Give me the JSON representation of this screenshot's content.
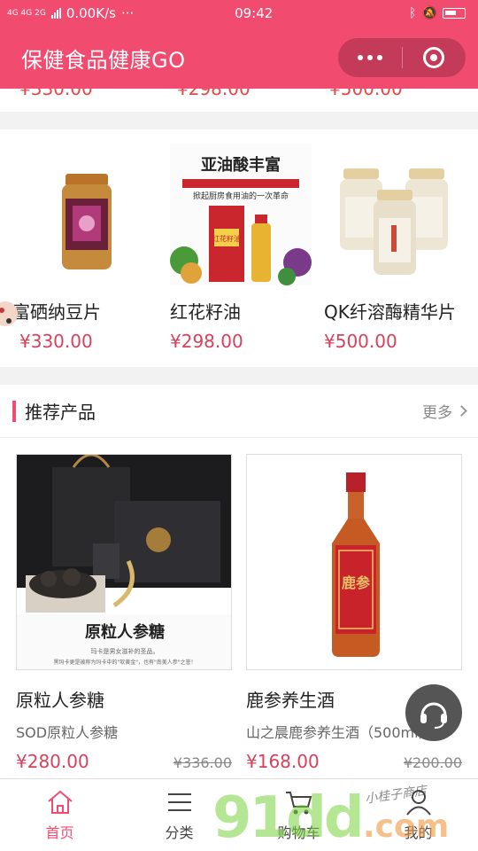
{
  "status_bar": {
    "network": "4G 4G 2G",
    "speed": "0.00K/s",
    "more": "···",
    "time": "09:42"
  },
  "header": {
    "title": "保健食品健康GO"
  },
  "hot_products": [
    {
      "name": "富硒纳豆片",
      "price": "¥330.00"
    },
    {
      "name": "红花籽油",
      "price": "¥298.00",
      "image_text": "亚油酸丰富",
      "image_subtext": "掀起厨房食用油的一次革命",
      "bottle_label": "红花籽油"
    },
    {
      "name": "QK纤溶酶精华片",
      "price": "¥500.00"
    }
  ],
  "recommend": {
    "title": "推荐产品",
    "more": "更多",
    "items": [
      {
        "name": "原粒人参糖",
        "desc": "SOD原粒人参糖",
        "price": "¥280.00",
        "old_price": "¥336.00",
        "image_text": "原粒人参糖",
        "image_small": "玛卡是男女滋补的圣品。",
        "image_small2": "黑玛卡更是被称为玛卡中的\"软黄金\"，也有\"南美人参\"之誉！"
      },
      {
        "name": "鹿参养生酒",
        "desc": "山之晨鹿参养生酒（500ml）",
        "price": "¥168.00",
        "old_price": "¥200.00",
        "label_text": "鹿参"
      }
    ]
  },
  "tabbar": [
    {
      "label": "首页",
      "icon": "home-icon"
    },
    {
      "label": "分类",
      "icon": "list-icon"
    },
    {
      "label": "购物车",
      "icon": "cart-icon"
    },
    {
      "label": "我的",
      "icon": "user-icon"
    }
  ],
  "watermark": {
    "text": "91dd",
    "domain": ".com",
    "handwriting": "小桂子商店"
  },
  "colors": {
    "brand": "#f14b6f",
    "price": "#d9405a"
  }
}
